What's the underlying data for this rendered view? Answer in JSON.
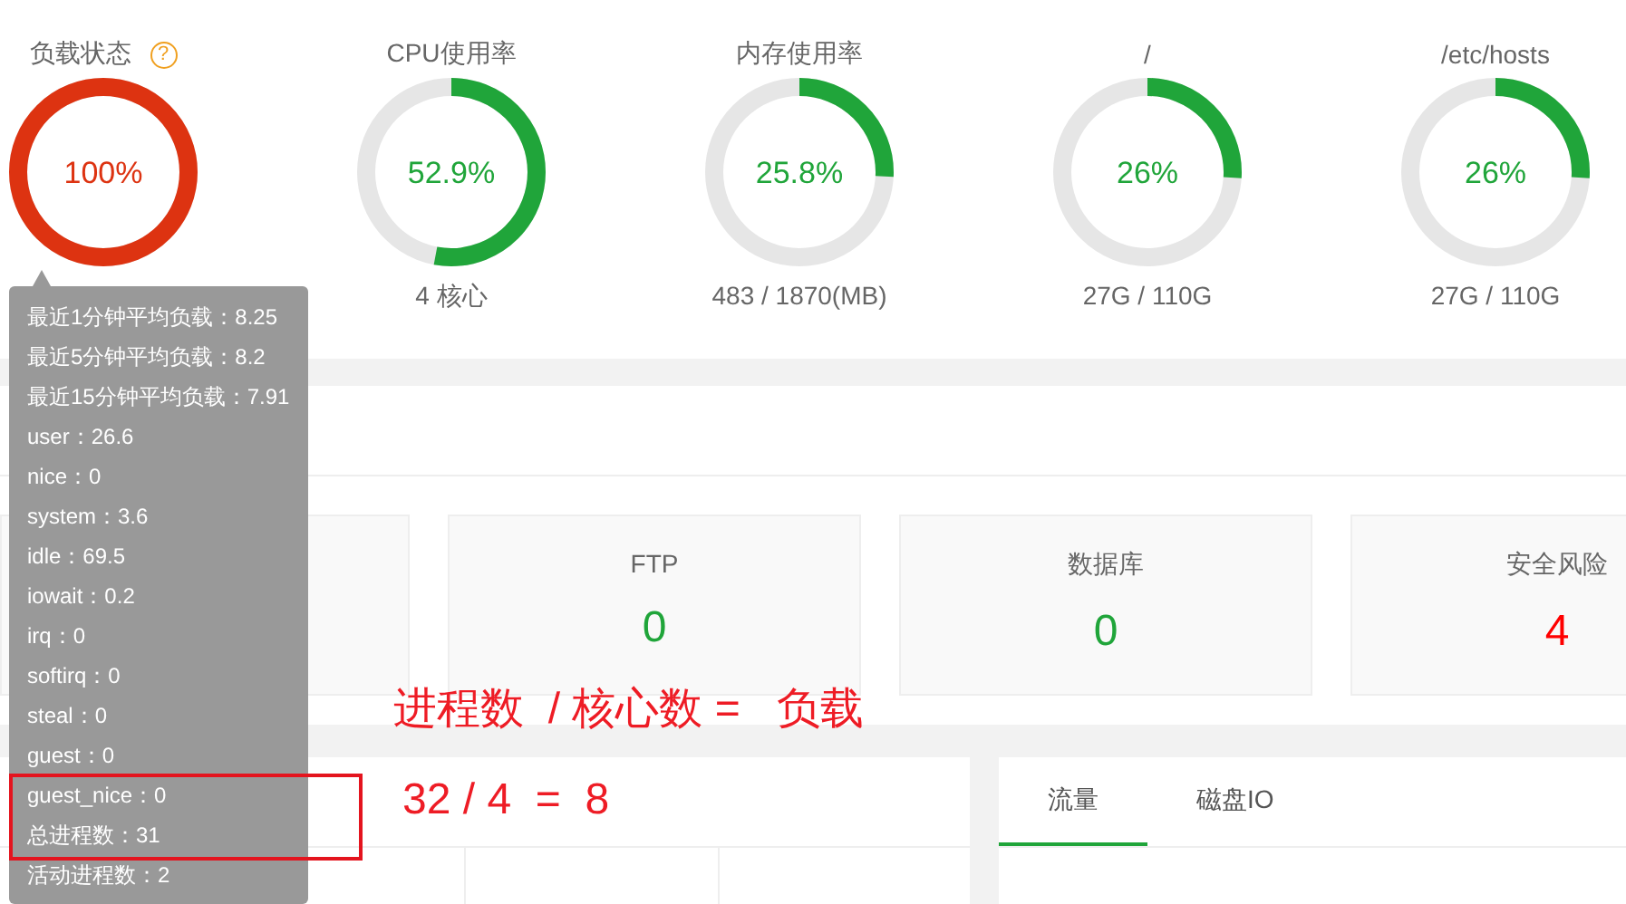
{
  "gauges": [
    {
      "title": "负载状态",
      "help_glyph": "?",
      "value": "100%",
      "level": 1,
      "color": "#dd3311"
    },
    {
      "title": "CPU使用率",
      "value": "52.9%",
      "level": 0.529,
      "color": "#20a53a",
      "subtitle": "4 核心"
    },
    {
      "title": "内存使用率",
      "value": "25.8%",
      "level": 0.258,
      "color": "#20a53a",
      "subtitle": "483 / 1870(MB)"
    },
    {
      "title": "/",
      "value": "26%",
      "level": 0.26,
      "color": "#20a53a",
      "subtitle": "27G / 110G"
    },
    {
      "title": "/etc/hosts",
      "value": "26%",
      "level": 0.26,
      "color": "#20a53a",
      "subtitle": "27G / 110G"
    }
  ],
  "overview_boxes": [
    {
      "label": "FTP",
      "value": "0",
      "color": "#20a53a"
    },
    {
      "label": "数据库",
      "value": "0",
      "color": "#20a53a"
    },
    {
      "label": "安全风险",
      "value": "4",
      "color": "#ff0000"
    }
  ],
  "traffic_tabs": [
    {
      "label": "流量",
      "selected": true
    },
    {
      "label": "磁盘IO",
      "selected": false
    }
  ],
  "tooltip_lines": [
    "最近1分钟平均负载：8.25",
    "最近5分钟平均负载：8.2",
    "最近15分钟平均负载：7.91",
    "user：26.6",
    "nice：0",
    "system：3.6",
    "idle：69.5",
    "iowait：0.2",
    "irq：0",
    "softirq：0",
    "steal：0",
    "guest：0",
    "guest_nice：0",
    "总进程数：31",
    "活动进程数：2"
  ],
  "annotations": [
    "进程数  / 核心数 =   负载",
    "32 / 4  =  8"
  ]
}
